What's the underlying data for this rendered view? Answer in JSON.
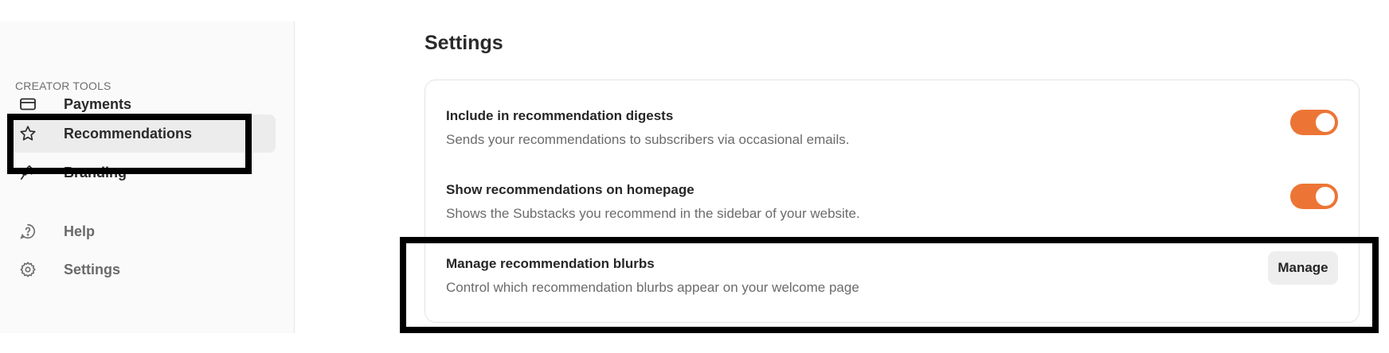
{
  "sidebar": {
    "section_label": "CREATOR TOOLS",
    "items": [
      {
        "label": "Payments",
        "icon": "credit-card-icon"
      },
      {
        "label": "Recommendations",
        "icon": "star-icon"
      },
      {
        "label": "Branding",
        "icon": "paintbrush-icon"
      },
      {
        "label": "Help",
        "icon": "help-circle-icon"
      },
      {
        "label": "Settings",
        "icon": "gear-icon"
      }
    ],
    "active_item": "Recommendations"
  },
  "main": {
    "title": "Settings",
    "settings": [
      {
        "title": "Include in recommendation digests",
        "description": "Sends your recommendations to subscribers via occasional emails.",
        "control": "toggle",
        "enabled": true
      },
      {
        "title": "Show recommendations on homepage",
        "description": "Shows the Substacks you recommend in the sidebar of your website.",
        "control": "toggle",
        "enabled": true
      },
      {
        "title": "Manage recommendation blurbs",
        "description": "Control which recommendation blurbs appear on your welcome page",
        "control": "button",
        "button_label": "Manage"
      }
    ]
  },
  "colors": {
    "accent": "#ec7535",
    "sidebar_bg": "#fafafa",
    "active_item_bg": "#ececec",
    "annotation_border": "#000000"
  }
}
